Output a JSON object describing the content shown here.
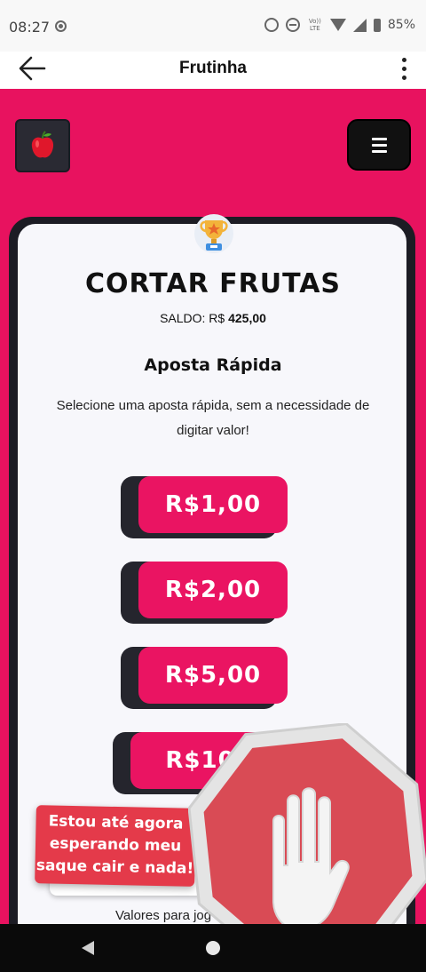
{
  "status_bar": {
    "time": "08:27",
    "lte": "Vo)) LTE",
    "battery": "85%"
  },
  "app_bar": {
    "title": "Frutinha"
  },
  "card": {
    "title": "CORTAR FRUTAS",
    "balance_label": "SALDO: R$",
    "balance_value": "425,00",
    "quick_title": "Aposta Rápida",
    "quick_description": "Selecione uma aposta rápida, sem a necessidade de digitar valor!",
    "bets": [
      "R$1,00",
      "R$2,00",
      "R$5,00",
      "R$10,"
    ],
    "values_note": "Valores para jog"
  },
  "overlay": {
    "sticker_text": "Estou até agora esperando meu saque cair e nada!"
  },
  "colors": {
    "brand_pink": "#e8125f",
    "dark": "#1c1c24",
    "stop_red": "#d94b55"
  }
}
